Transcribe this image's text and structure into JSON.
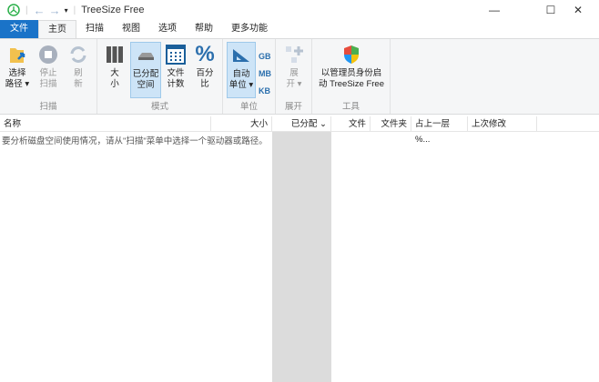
{
  "title": "TreeSize Free",
  "window": {
    "minimize": "—",
    "maximize": "☐",
    "close": "✕"
  },
  "tabs": [
    "文件",
    "主页",
    "扫描",
    "视图",
    "选项",
    "帮助",
    "更多功能"
  ],
  "ribbon": {
    "scan": {
      "label": "扫描",
      "choose": [
        "选择",
        "路径 ▾"
      ],
      "stop": [
        "停止",
        "扫描"
      ],
      "refresh": [
        "刷",
        "新"
      ]
    },
    "mode": {
      "label": "模式",
      "size": [
        "大",
        "小"
      ],
      "allocated": [
        "已分配",
        "空间"
      ],
      "filecount": [
        "文件",
        "计数"
      ],
      "percent": [
        "百分",
        "比"
      ]
    },
    "unit": {
      "label": "单位",
      "auto": [
        "自动",
        "单位 ▾"
      ],
      "gb": "GB",
      "mb": "MB",
      "kb": "KB"
    },
    "expand": {
      "label": "展开",
      "btn": [
        "展",
        "开 ▾"
      ]
    },
    "tools": {
      "label": "工具",
      "admin": [
        "以管理员身份启",
        "动 TreeSize Free"
      ]
    }
  },
  "columns": {
    "name": "名称",
    "size": "大小",
    "allocated": "已分配 ⌄",
    "files": "文件",
    "folders": "文件夹",
    "percent": "占上一层 %...",
    "modified": "上次修改"
  },
  "message": "要分析磁盘空间使用情况，请从\"扫描\"菜单中选择一个驱动器或路径。"
}
